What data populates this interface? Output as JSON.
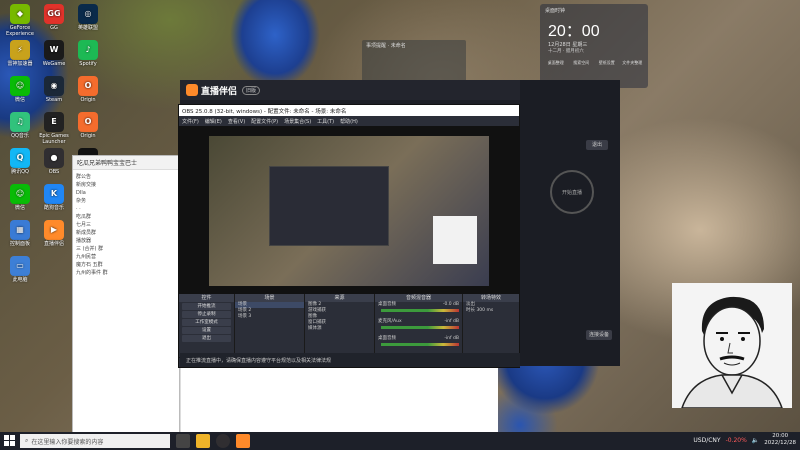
{
  "desktop": {
    "icons": [
      {
        "label": "GeForce Experience",
        "color": "#77b900",
        "glyph": "◆"
      },
      {
        "label": "GG",
        "color": "#e0322a",
        "glyph": "GG"
      },
      {
        "label": "英雄联盟",
        "color": "#0a2a4a",
        "glyph": "◎"
      },
      {
        "label": "雷神加速器",
        "color": "#c8a21c",
        "glyph": "⚡"
      },
      {
        "label": "WeGame",
        "color": "#1a1a1a",
        "glyph": "W"
      },
      {
        "label": "Spotify",
        "color": "#1db954",
        "glyph": "♪"
      },
      {
        "label": "微信",
        "color": "#09bb07",
        "glyph": "☺"
      },
      {
        "label": "Steam",
        "color": "#1b2838",
        "glyph": "◉"
      },
      {
        "label": "Origin",
        "color": "#f56c2d",
        "glyph": "O"
      },
      {
        "label": "QQ音乐",
        "color": "#31c27c",
        "glyph": "♫"
      },
      {
        "label": "Epic Games Launcher",
        "color": "#222",
        "glyph": "E"
      },
      {
        "label": "Origin",
        "color": "#f56c2d",
        "glyph": "O"
      },
      {
        "label": "腾讯QQ",
        "color": "#12b7f5",
        "glyph": "Q"
      },
      {
        "label": "OBS",
        "color": "#302e31",
        "glyph": "●"
      },
      {
        "label": "剪映专业版",
        "color": "#111",
        "glyph": "✂"
      },
      {
        "label": "微信",
        "color": "#09bb07",
        "glyph": "☺"
      },
      {
        "label": "酷狗音乐",
        "color": "#2086f4",
        "glyph": "K"
      },
      {
        "label": "WPS",
        "color": "#e8452c",
        "glyph": "S"
      },
      {
        "label": "控制面板",
        "color": "#3a7bd5",
        "glyph": "▦"
      },
      {
        "label": "直播伴侣",
        "color": "#ff8a2a",
        "glyph": "▶"
      },
      {
        "label": "百度网盘",
        "color": "#2a82e4",
        "glyph": "☁"
      },
      {
        "label": "此电脑",
        "color": "#3d7fd6",
        "glyph": "▭"
      }
    ]
  },
  "clock_widget": {
    "title": "桌面时钟",
    "time": "20：00",
    "date": "12月28日",
    "weekday": "星期三",
    "sub": "十二月 · 腊月初六",
    "shortcuts": [
      "桌面整理",
      "搜索空间",
      "壁纸设置",
      "文件夹整理"
    ]
  },
  "note_widget": {
    "title": "事项提醒 · 未命名"
  },
  "chat": {
    "title": "吃瓜兄弟鸭鸭宝宝巴士",
    "items": [
      "群公告",
      "新房交接",
      "DIla",
      "杂务",
      "· ·",
      "吃瓜群",
      "七月三",
      "新成员群",
      "播放器",
      "三 (合并) 群",
      "九州民营",
      "魔方石 五群",
      "九州的事件 群"
    ]
  },
  "live": {
    "app_name": "直播伴侣",
    "badge": "旧版",
    "start_label": "开始直播",
    "right_labels": [
      "退出",
      "开始直播"
    ],
    "confirm_btn": "连接设备"
  },
  "obs": {
    "title": "OBS 25.0.8 (32-bit, windows) - 配置文件: 未命名 - 场景: 未命名",
    "menu": [
      "文件(F)",
      "编辑(E)",
      "查看(V)",
      "配置文件(P)",
      "场景集合(S)",
      "工具(T)",
      "帮助(H)"
    ],
    "docks": {
      "controls": {
        "title": "控件",
        "buttons": [
          "开始推流",
          "停止录制",
          "工作室模式",
          "设置",
          "退出"
        ]
      },
      "scenes": {
        "title": "场景",
        "items": [
          "场景",
          "场景 2",
          "场景 3"
        ]
      },
      "sources": {
        "title": "来源",
        "items": [
          "图像 2",
          "游戏捕获",
          "图像",
          "窗口捕获",
          "媒体源"
        ]
      },
      "mixer": {
        "title": "音频混音器",
        "channels": [
          {
            "name": "桌面音频",
            "db": "-0.0 dB"
          },
          {
            "name": "麦克风/Aux",
            "db": "-inf dB"
          },
          {
            "name": "桌面音频",
            "db": "-inf dB"
          }
        ]
      },
      "transitions": {
        "title": "转场特效",
        "mode": "淡出",
        "duration_label": "时长",
        "duration": "300 ms"
      }
    },
    "status": {
      "live": "LIVE: 00:00:00",
      "rec": "REC: 00:00:00",
      "cpu": "CPU: 4.4%, 30.00 fps"
    }
  },
  "notification": {
    "text": "正在推流直播中，请确保直播内容遵守平台规范以及相关法律法规"
  },
  "taskbar": {
    "search_placeholder": "在这里输入你要搜索的内容",
    "currency": "USD/CNY",
    "change": "-0.20%",
    "time": "20:00",
    "date": "2022/12/28"
  }
}
